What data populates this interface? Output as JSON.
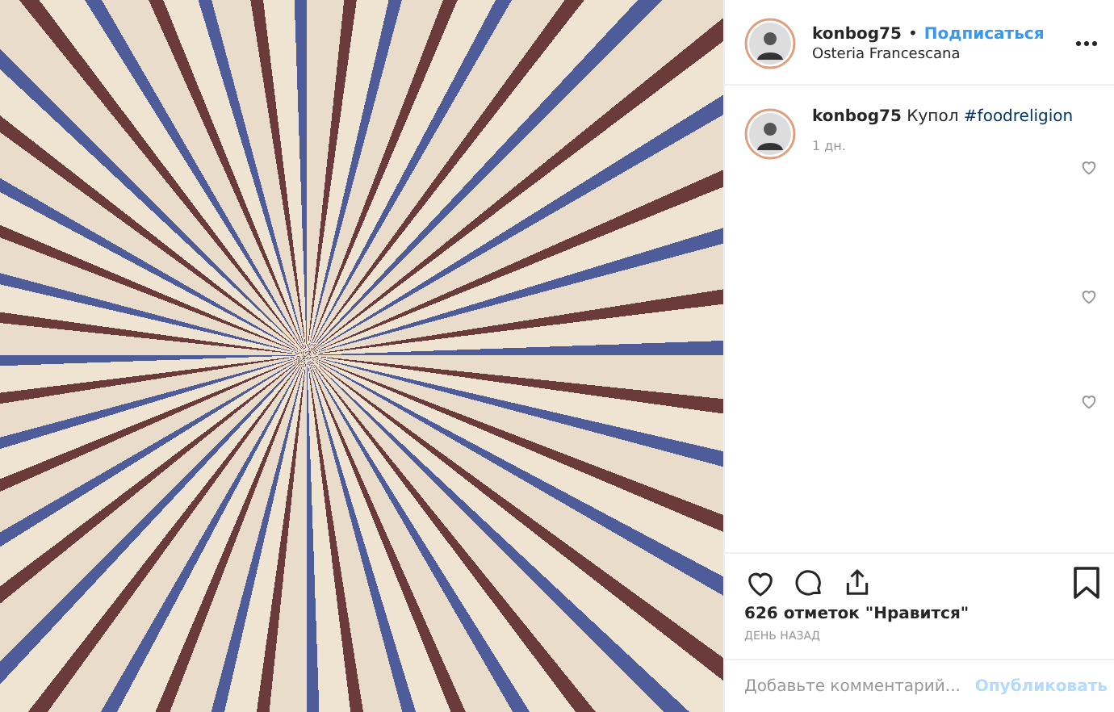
{
  "header": {
    "username": "konbog75",
    "separator": "•",
    "follow_label": "Подписаться",
    "location": "Osteria Francescana"
  },
  "caption": {
    "username": "konbog75",
    "text": "Купол",
    "hashtag": "#foodreligion",
    "time": "1 дн."
  },
  "comment_likes": [
    {
      "liked": false
    },
    {
      "liked": false
    },
    {
      "liked": false
    }
  ],
  "likes": "626 отметок \"Нравится\"",
  "timestamp": "ДЕНЬ НАЗАД",
  "comment_box": {
    "placeholder": "Добавьте комментарий...",
    "post_label": "Опубликовать",
    "disabled": true
  }
}
